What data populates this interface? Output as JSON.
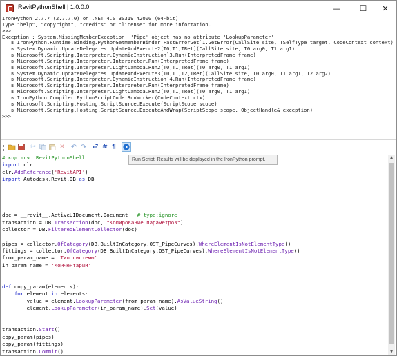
{
  "window": {
    "title": "RevitPythonShell | 1.0.0.0",
    "minimize": "—",
    "maximize": "☐",
    "close": "✕"
  },
  "console_lines": [
    "IronPython 2.7.7 (2.7.7.0) on .NET 4.0.30319.42000 (64-bit)",
    "Type \"help\", \"copyright\", \"credits\" or \"license\" for more information.",
    ">>>",
    "Exception : System.MissingMemberException: 'Pipe' object has no attribute 'LookupParameter'",
    "   в IronPython.Runtime.Binding.PythonGetMemberBinder.FastErrorGet`1.GetError(CallSite site, TSelfType target, CodeContext context)",
    "   в System.Dynamic.UpdateDelegates.UpdateAndExecute2[T0,T1,TRet](CallSite site, T0 arg0, T1 arg1)",
    "   в Microsoft.Scripting.Interpreter.DynamicInstruction`3.Run(InterpretedFrame frame)",
    "   в Microsoft.Scripting.Interpreter.Interpreter.Run(InterpretedFrame frame)",
    "   в Microsoft.Scripting.Interpreter.LightLambda.Run2[T0,T1,TRet](T0 arg0, T1 arg1)",
    "   в System.Dynamic.UpdateDelegates.UpdateAndExecute3[T0,T1,T2,TRet](CallSite site, T0 arg0, T1 arg1, T2 arg2)",
    "   в Microsoft.Scripting.Interpreter.DynamicInstruction`4.Run(InterpretedFrame frame)",
    "   в Microsoft.Scripting.Interpreter.Interpreter.Run(InterpretedFrame frame)",
    "   в Microsoft.Scripting.Interpreter.LightLambda.Run2[T0,T1,TRet](T0 arg0, T1 arg1)",
    "   в IronPython.Compiler.PythonScriptCode.RunWorker(CodeContext ctx)",
    "   в Microsoft.Scripting.Hosting.ScriptSource.Execute(ScriptScope scope)",
    "   в Microsoft.Scripting.Hosting.ScriptSource.ExecuteAndWrap(ScriptScope scope, ObjectHandle& exception)",
    ">>>"
  ],
  "toolbar": {
    "icons": [
      "open-file",
      "save",
      "cut",
      "copy",
      "paste",
      "delete",
      "undo",
      "redo",
      "word-wrap",
      "comment",
      "show-whitespace",
      "run-script"
    ],
    "tooltip": "Run Script. Results will be displayed in the IronPython prompt."
  },
  "editor_lines": [
    [
      {
        "t": "# код для  RevitPythonShell",
        "c": "com"
      }
    ],
    [
      {
        "t": "import",
        "c": "kw"
      },
      {
        "t": " clr",
        "c": ""
      }
    ],
    [
      {
        "t": "clr.",
        "c": ""
      },
      {
        "t": "AddReference",
        "c": "meth"
      },
      {
        "t": "(",
        "c": ""
      },
      {
        "t": "'RevitAPI'",
        "c": "str"
      },
      {
        "t": ")",
        "c": ""
      }
    ],
    [
      {
        "t": "import",
        "c": "kw"
      },
      {
        "t": " Autodesk.Revit.DB ",
        "c": ""
      },
      {
        "t": "as",
        "c": "kw"
      },
      {
        "t": " DB",
        "c": ""
      }
    ],
    [],
    [],
    [],
    [],
    [
      {
        "t": "doc = __revit__.ActiveUIDocument.Document   ",
        "c": ""
      },
      {
        "t": "# type:ignore",
        "c": "com"
      }
    ],
    [
      {
        "t": "transaction = DB.",
        "c": ""
      },
      {
        "t": "Transaction",
        "c": "meth"
      },
      {
        "t": "(doc, ",
        "c": ""
      },
      {
        "t": "\"Копирование параметров\"",
        "c": "str"
      },
      {
        "t": ")",
        "c": ""
      }
    ],
    [
      {
        "t": "collector = DB.",
        "c": ""
      },
      {
        "t": "FilteredElementCollector",
        "c": "meth"
      },
      {
        "t": "(doc)",
        "c": ""
      }
    ],
    [],
    [
      {
        "t": "pipes = collector.",
        "c": ""
      },
      {
        "t": "OfCategory",
        "c": "meth"
      },
      {
        "t": "(DB.BuiltInCategory.OST_PipeCurves).",
        "c": ""
      },
      {
        "t": "WhereElementIsNotElementType",
        "c": "meth"
      },
      {
        "t": "()",
        "c": ""
      }
    ],
    [
      {
        "t": "fittings = collector.",
        "c": ""
      },
      {
        "t": "OfCategory",
        "c": "meth"
      },
      {
        "t": "(DB.BuiltInCategory.OST_PipeCurves).",
        "c": ""
      },
      {
        "t": "WhereElementIsNotElementType",
        "c": "meth"
      },
      {
        "t": "()",
        "c": ""
      }
    ],
    [
      {
        "t": "from_param_name = ",
        "c": ""
      },
      {
        "t": "'Тип системы'",
        "c": "str"
      }
    ],
    [
      {
        "t": "in_param_name = ",
        "c": ""
      },
      {
        "t": "'Комментарии'",
        "c": "str"
      }
    ],
    [],
    [],
    [
      {
        "t": "def",
        "c": "kw"
      },
      {
        "t": " copy_param(elements):",
        "c": ""
      }
    ],
    [
      {
        "t": "    ",
        "c": ""
      },
      {
        "t": "for",
        "c": "kw"
      },
      {
        "t": " element ",
        "c": ""
      },
      {
        "t": "in",
        "c": "kw"
      },
      {
        "t": " elements:",
        "c": ""
      }
    ],
    [
      {
        "t": "        value = element.",
        "c": ""
      },
      {
        "t": "LookupParameter",
        "c": "meth"
      },
      {
        "t": "(from_param_name).",
        "c": ""
      },
      {
        "t": "AsValueString",
        "c": "meth"
      },
      {
        "t": "()",
        "c": ""
      }
    ],
    [
      {
        "t": "        element.",
        "c": ""
      },
      {
        "t": "LookupParameter",
        "c": "meth"
      },
      {
        "t": "(in_param_name).",
        "c": ""
      },
      {
        "t": "Set",
        "c": "meth"
      },
      {
        "t": "(value)",
        "c": ""
      }
    ],
    [],
    [],
    [
      {
        "t": "transaction.",
        "c": ""
      },
      {
        "t": "Start",
        "c": "meth"
      },
      {
        "t": "()",
        "c": ""
      }
    ],
    [
      {
        "t": "copy_param(pipes)",
        "c": ""
      }
    ],
    [
      {
        "t": "copy_param(fittings)",
        "c": ""
      }
    ],
    [
      {
        "t": "transaction.",
        "c": ""
      },
      {
        "t": "Commit",
        "c": "meth"
      },
      {
        "t": "()",
        "c": ""
      }
    ]
  ]
}
